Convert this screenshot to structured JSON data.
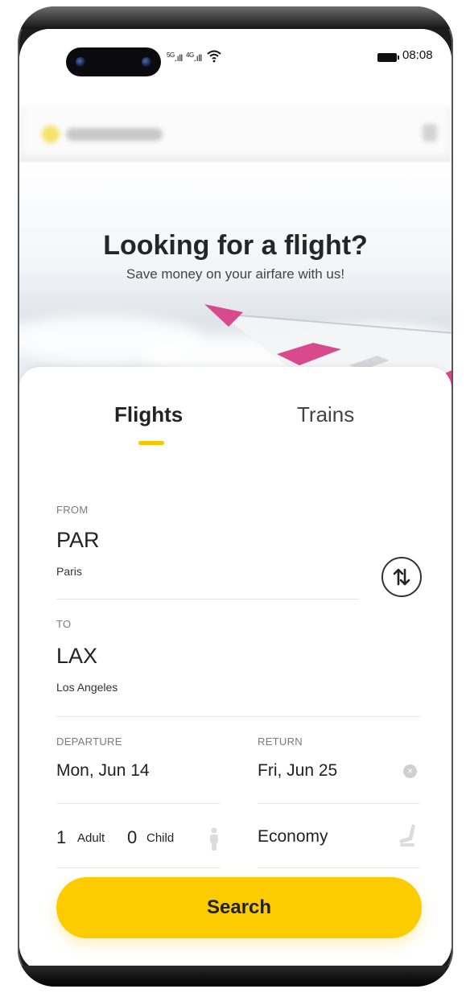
{
  "status_bar": {
    "signal_1": "5G",
    "signal_2": "4G",
    "time": "08:08"
  },
  "hero": {
    "title": "Looking for a flight?",
    "subtitle": "Save money on your airfare with us!"
  },
  "tabs": [
    {
      "label": "Flights",
      "active": true
    },
    {
      "label": "Trains",
      "active": false
    }
  ],
  "from": {
    "label": "FROM",
    "code": "PAR",
    "city": "Paris"
  },
  "to": {
    "label": "TO",
    "code": "LAX",
    "city": "Los Angeles"
  },
  "departure": {
    "label": "DEPARTURE",
    "value": "Mon, Jun 14"
  },
  "return": {
    "label": "RETURN",
    "value": "Fri, Jun 25"
  },
  "passengers": {
    "adult_count": "1",
    "adult_label": "Adult",
    "child_count": "0",
    "child_label": "Child"
  },
  "cabin_class": "Economy",
  "search_button": "Search",
  "colors": {
    "accent": "#fccb00",
    "wing": "#d94a8c"
  }
}
